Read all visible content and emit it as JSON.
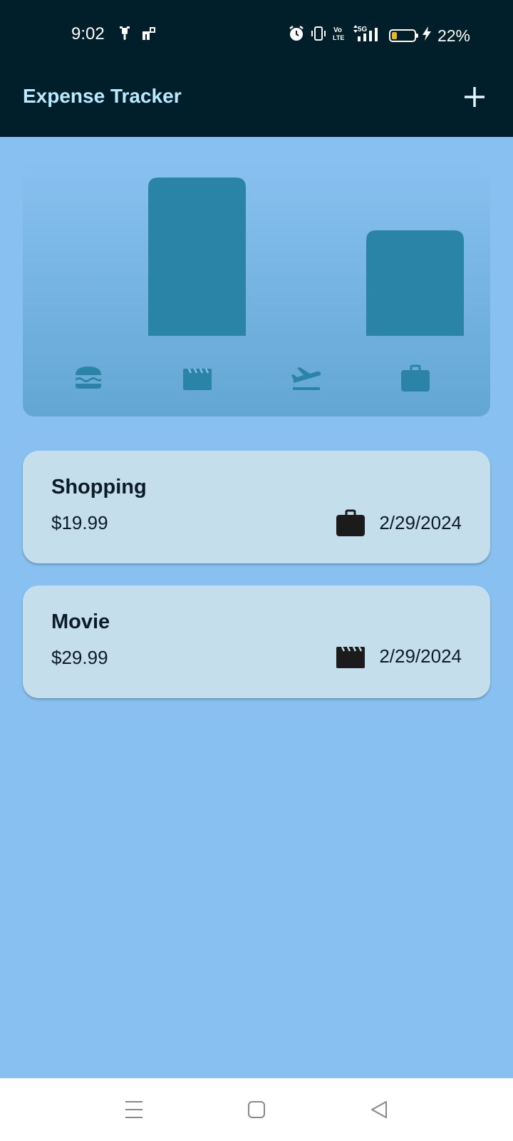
{
  "status_bar": {
    "time": "9:02",
    "battery_percent": "22%",
    "battery_level": 0.22,
    "battery_color": "#f2b419",
    "network": "5G",
    "left_icons": [
      "scooter-icon",
      "app-notification-icon"
    ],
    "right_icons": [
      "alarm-icon",
      "vibrate-icon",
      "volte-icon",
      "signal-icon",
      "battery-icon",
      "charging-icon"
    ]
  },
  "app_bar": {
    "title": "Expense Tracker",
    "add_icon": "plus-icon"
  },
  "chart_data": {
    "type": "bar",
    "categories": [
      "food",
      "leisure",
      "travel",
      "work"
    ],
    "category_icons": [
      "hamburger-icon",
      "movie-icon",
      "flight-takeoff-icon",
      "briefcase-icon"
    ],
    "values": [
      0,
      29.99,
      0,
      19.99
    ],
    "ylim": [
      0,
      29.99
    ],
    "bar_color": "#2a84a8",
    "grid": false,
    "legend": "none"
  },
  "expenses": [
    {
      "title": "Shopping",
      "amount": "$19.99",
      "date": "2/29/2024",
      "icon": "briefcase-icon"
    },
    {
      "title": "Movie",
      "amount": "$29.99",
      "date": "2/29/2024",
      "icon": "movie-icon"
    }
  ],
  "nav_bar": {
    "buttons": [
      "menu-icon",
      "home-icon",
      "back-icon"
    ]
  },
  "colors": {
    "app_bar_bg": "#001f2a",
    "title_color": "#b9eaff",
    "background": "#88c1f1",
    "card_bg": "#c5deeb",
    "text_dark": "#0b1c26"
  }
}
